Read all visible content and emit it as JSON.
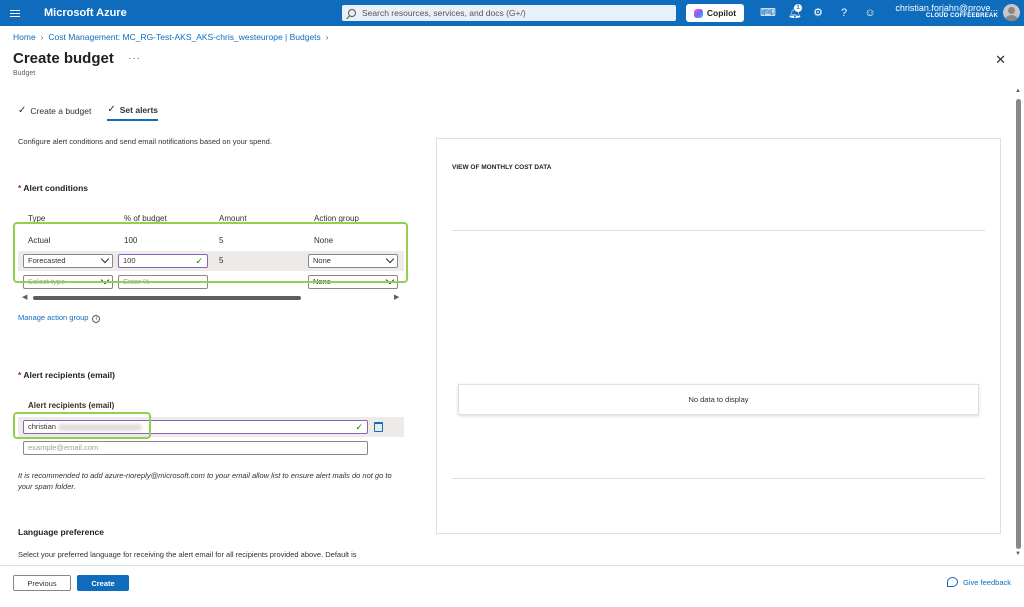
{
  "topbar": {
    "brand": "Microsoft Azure",
    "search_placeholder": "Search resources, services, and docs (G+/)",
    "copilot_label": "Copilot",
    "notification_count": "1",
    "user": "christian.forjahn@prove...",
    "tenant": "CLOUD COFFEEBREAK"
  },
  "breadcrumb": [
    "Home",
    "Cost Management: MC_RG-Test-AKS_AKS-chris_westeurope | Budgets"
  ],
  "header": {
    "title": "Create budget",
    "subtitle": "Budget",
    "more": "···"
  },
  "tabs": [
    {
      "label": "Create a budget",
      "active": false
    },
    {
      "label": "Set alerts",
      "active": true
    }
  ],
  "description": "Configure alert conditions and send email notifications based on your spend.",
  "alert_conditions": {
    "label": "Alert conditions",
    "columns": [
      "Type",
      "% of budget",
      "Amount",
      "Action group"
    ],
    "rows": [
      {
        "type": "Actual",
        "percent": "100",
        "amount": "5",
        "action_group": "None"
      },
      {
        "type": "Forecasted",
        "percent": "100",
        "amount": "5",
        "action_group": "None"
      },
      {
        "type_placeholder": "Select type",
        "percent_placeholder": "Enter %",
        "amount": "-",
        "action_group": "None"
      }
    ],
    "manage_link": "Manage action group"
  },
  "alert_recipients": {
    "section_label": "Alert recipients (email)",
    "column_label": "Alert recipients (email)",
    "email_value": "christian",
    "email_placeholder": "example@email.com",
    "note": "It is recommended to add azure-noreply@microsoft.com to your email allow list to ensure alert mails do not go to your spam folder."
  },
  "language": {
    "label": "Language preference",
    "description": "Select your preferred language for receiving the alert email for all recipients provided above. Default is"
  },
  "chart_card": {
    "title": "VIEW OF MONTHLY COST DATA",
    "no_data": "No data to display"
  },
  "footer": {
    "previous": "Previous",
    "create": "Create",
    "feedback": "Give feedback"
  },
  "colors": {
    "accent": "#0f6cbd",
    "highlight": "#92d050",
    "required": "#a4262c"
  }
}
